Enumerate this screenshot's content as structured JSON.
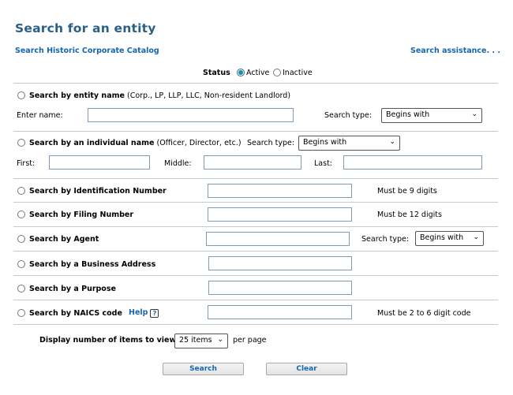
{
  "page": {
    "title": "Search for an entity",
    "historic_link": "Search Historic Corporate Catalog",
    "assist_link": "Search assistance. . ."
  },
  "status": {
    "label": "Status",
    "options": [
      "Active",
      "Inactive"
    ],
    "selected": "Active"
  },
  "entity_name": {
    "title": "Search by entity name",
    "hint": "(Corp., LP, LLP, LLC, Non-resident Landlord)",
    "enter_label": "Enter name:",
    "search_type_label": "Search type:",
    "search_type_value": "Begins with"
  },
  "individual": {
    "title": "Search by an individual name",
    "hint": "(Officer, Director, etc.)",
    "search_type_label": "Search type:",
    "search_type_value": "Begins with",
    "first_label": "First:",
    "middle_label": "Middle:",
    "last_label": "Last:"
  },
  "id_number": {
    "title": "Search by Identification Number",
    "note": "Must be 9 digits"
  },
  "filing_number": {
    "title": "Search by Filing Number",
    "note": "Must be 12 digits"
  },
  "agent": {
    "title": "Search by Agent",
    "search_type_label": "Search type:",
    "search_type_value": "Begins with"
  },
  "business_address": {
    "title": "Search by a Business Address"
  },
  "purpose": {
    "title": "Search by a Purpose"
  },
  "naics": {
    "title": "Search by NAICS code",
    "help_label": "Help",
    "help_icon": "?",
    "note": "Must be 2 to 6 digit code"
  },
  "display": {
    "label": "Display number of items to view:",
    "value": "25 items",
    "suffix": "per page"
  },
  "buttons": {
    "search": "Search",
    "clear": "Clear"
  },
  "icons": {
    "dropdown": "chevron-down-icon",
    "help": "help-icon"
  },
  "colors": {
    "title": "#2c5f86",
    "link": "#1466b0",
    "radio_selected": "#1b88b8"
  }
}
